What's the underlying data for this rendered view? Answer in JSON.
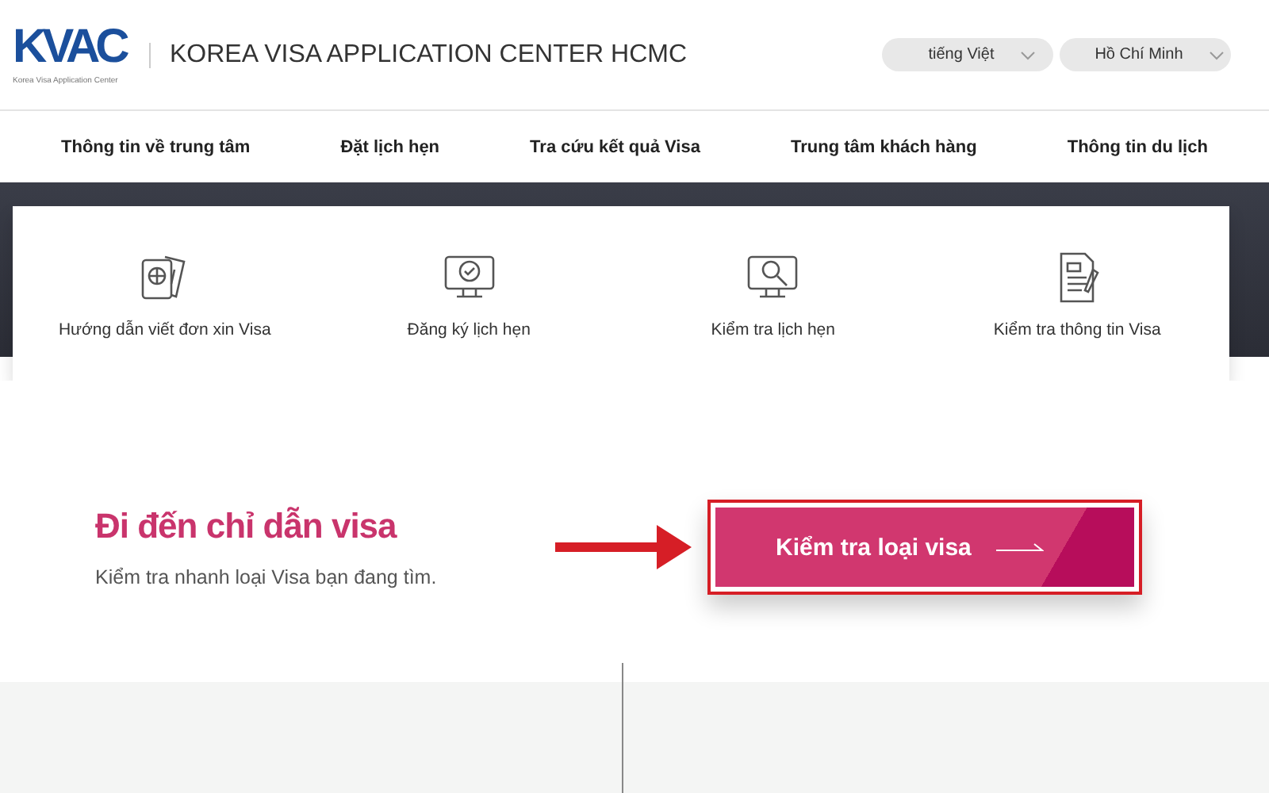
{
  "header": {
    "logo": "KVAC",
    "logo_subtitle": "Korea Visa Application Center",
    "title": "KOREA VISA APPLICATION CENTER HCMC",
    "selectors": [
      {
        "label": "tiếng Việt"
      },
      {
        "label": "Hồ Chí Minh"
      }
    ]
  },
  "nav": [
    "Thông tin về trung tâm",
    "Đặt lịch hẹn",
    "Tra cứu kết quả Visa",
    "Trung tâm khách hàng",
    "Thông tin du lịch"
  ],
  "services": [
    {
      "kind": "passport",
      "label": "Hướng dẫn viết đơn xin Visa"
    },
    {
      "kind": "monitor-check",
      "label": "Đăng ký lịch hẹn"
    },
    {
      "kind": "monitor-search",
      "label": "Kiểm tra lịch hẹn"
    },
    {
      "kind": "document",
      "label": "Kiểm tra thông tin Visa"
    }
  ],
  "guide": {
    "title": "Đi đến chỉ dẫn visa",
    "subtitle": "Kiểm tra nhanh loại Visa bạn đang tìm.",
    "button": "Kiểm tra loại visa"
  }
}
